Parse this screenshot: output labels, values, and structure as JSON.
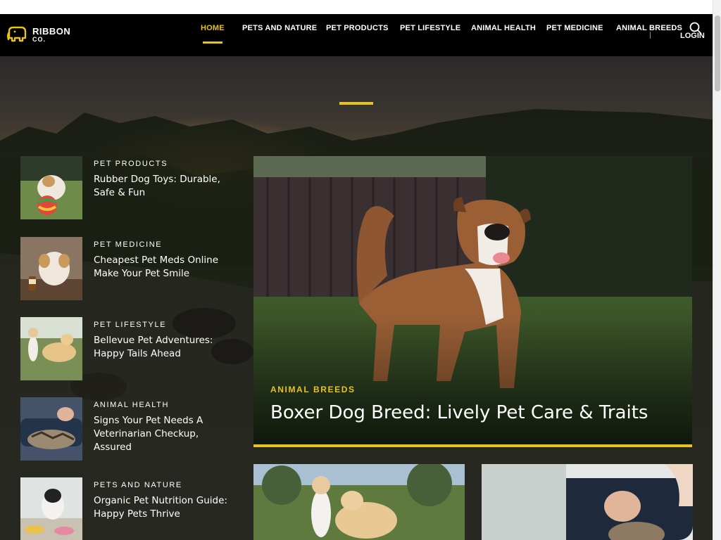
{
  "site": {
    "logo_line1": "RIBBON",
    "logo_line2": "CO.",
    "logo_icon": "elephant-logo-icon"
  },
  "nav": {
    "items": [
      {
        "label": "HOME",
        "active": true
      },
      {
        "label": "PETS AND NATURE",
        "active": false
      },
      {
        "label": "PET PRODUCTS",
        "active": false
      },
      {
        "label": "PET LIFESTYLE",
        "active": false
      },
      {
        "label": "ANIMAL HEALTH",
        "active": false
      },
      {
        "label": "PET MEDICINE",
        "active": false
      },
      {
        "label": "ANIMAL BREEDS",
        "active": false
      }
    ],
    "search_icon": "search-icon",
    "login_label": "LOGIN"
  },
  "sidebar_posts": [
    {
      "category": "PET PRODUCTS",
      "title": "Rubber Dog Toys: Durable, Safe & Fun"
    },
    {
      "category": "PET MEDICINE",
      "title": "Cheapest Pet Meds Online Make Your Pet Smile"
    },
    {
      "category": "PET LIFESTYLE",
      "title": "Bellevue Pet Adventures: Happy Tails Ahead"
    },
    {
      "category": "ANIMAL HEALTH",
      "title": "Signs Your Pet Needs A Veterinarian Checkup, Assured"
    },
    {
      "category": "PETS AND NATURE",
      "title": "Organic Pet Nutrition Guide: Happy Pets Thrive"
    }
  ],
  "featured": {
    "category": "ANIMAL BREEDS",
    "title": "Boxer Dog Breed: Lively Pet Care & Traits"
  },
  "colors": {
    "accent": "#e8c21d",
    "header_bg": "#000000",
    "text": "#ffffff"
  }
}
